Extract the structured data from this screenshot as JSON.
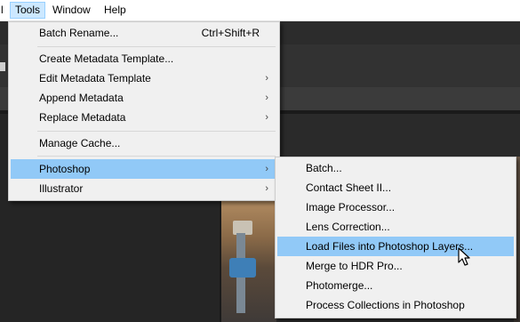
{
  "menubar": {
    "items": [
      {
        "label": "l"
      },
      {
        "label": "Tools"
      },
      {
        "label": "Window"
      },
      {
        "label": "Help"
      }
    ]
  },
  "tools_menu": {
    "items": [
      {
        "label": "Batch Rename...",
        "shortcut": "Ctrl+Shift+R"
      },
      {
        "label": "Create Metadata Template..."
      },
      {
        "label": "Edit Metadata Template",
        "submenu_arrow": "›"
      },
      {
        "label": "Append Metadata",
        "submenu_arrow": "›"
      },
      {
        "label": "Replace Metadata",
        "submenu_arrow": "›"
      },
      {
        "label": "Manage Cache..."
      },
      {
        "label": "Photoshop",
        "submenu_arrow": "›"
      },
      {
        "label": "Illustrator",
        "submenu_arrow": "›"
      }
    ]
  },
  "photoshop_menu": {
    "items": [
      {
        "label": "Batch..."
      },
      {
        "label": "Contact Sheet II..."
      },
      {
        "label": "Image Processor..."
      },
      {
        "label": "Lens Correction..."
      },
      {
        "label": "Load Files into Photoshop Layers..."
      },
      {
        "label": "Merge to HDR Pro..."
      },
      {
        "label": "Photomerge..."
      },
      {
        "label": "Process Collections in Photoshop"
      }
    ]
  },
  "colors": {
    "menu_bg": "#f0f0f0",
    "highlight": "#91c9f7",
    "menubar_active": "#cce8ff",
    "app_bg": "#1e1e1e"
  },
  "icons": {
    "cursor": "mouse-pointer-icon",
    "submenu": "chevron-right-icon"
  }
}
